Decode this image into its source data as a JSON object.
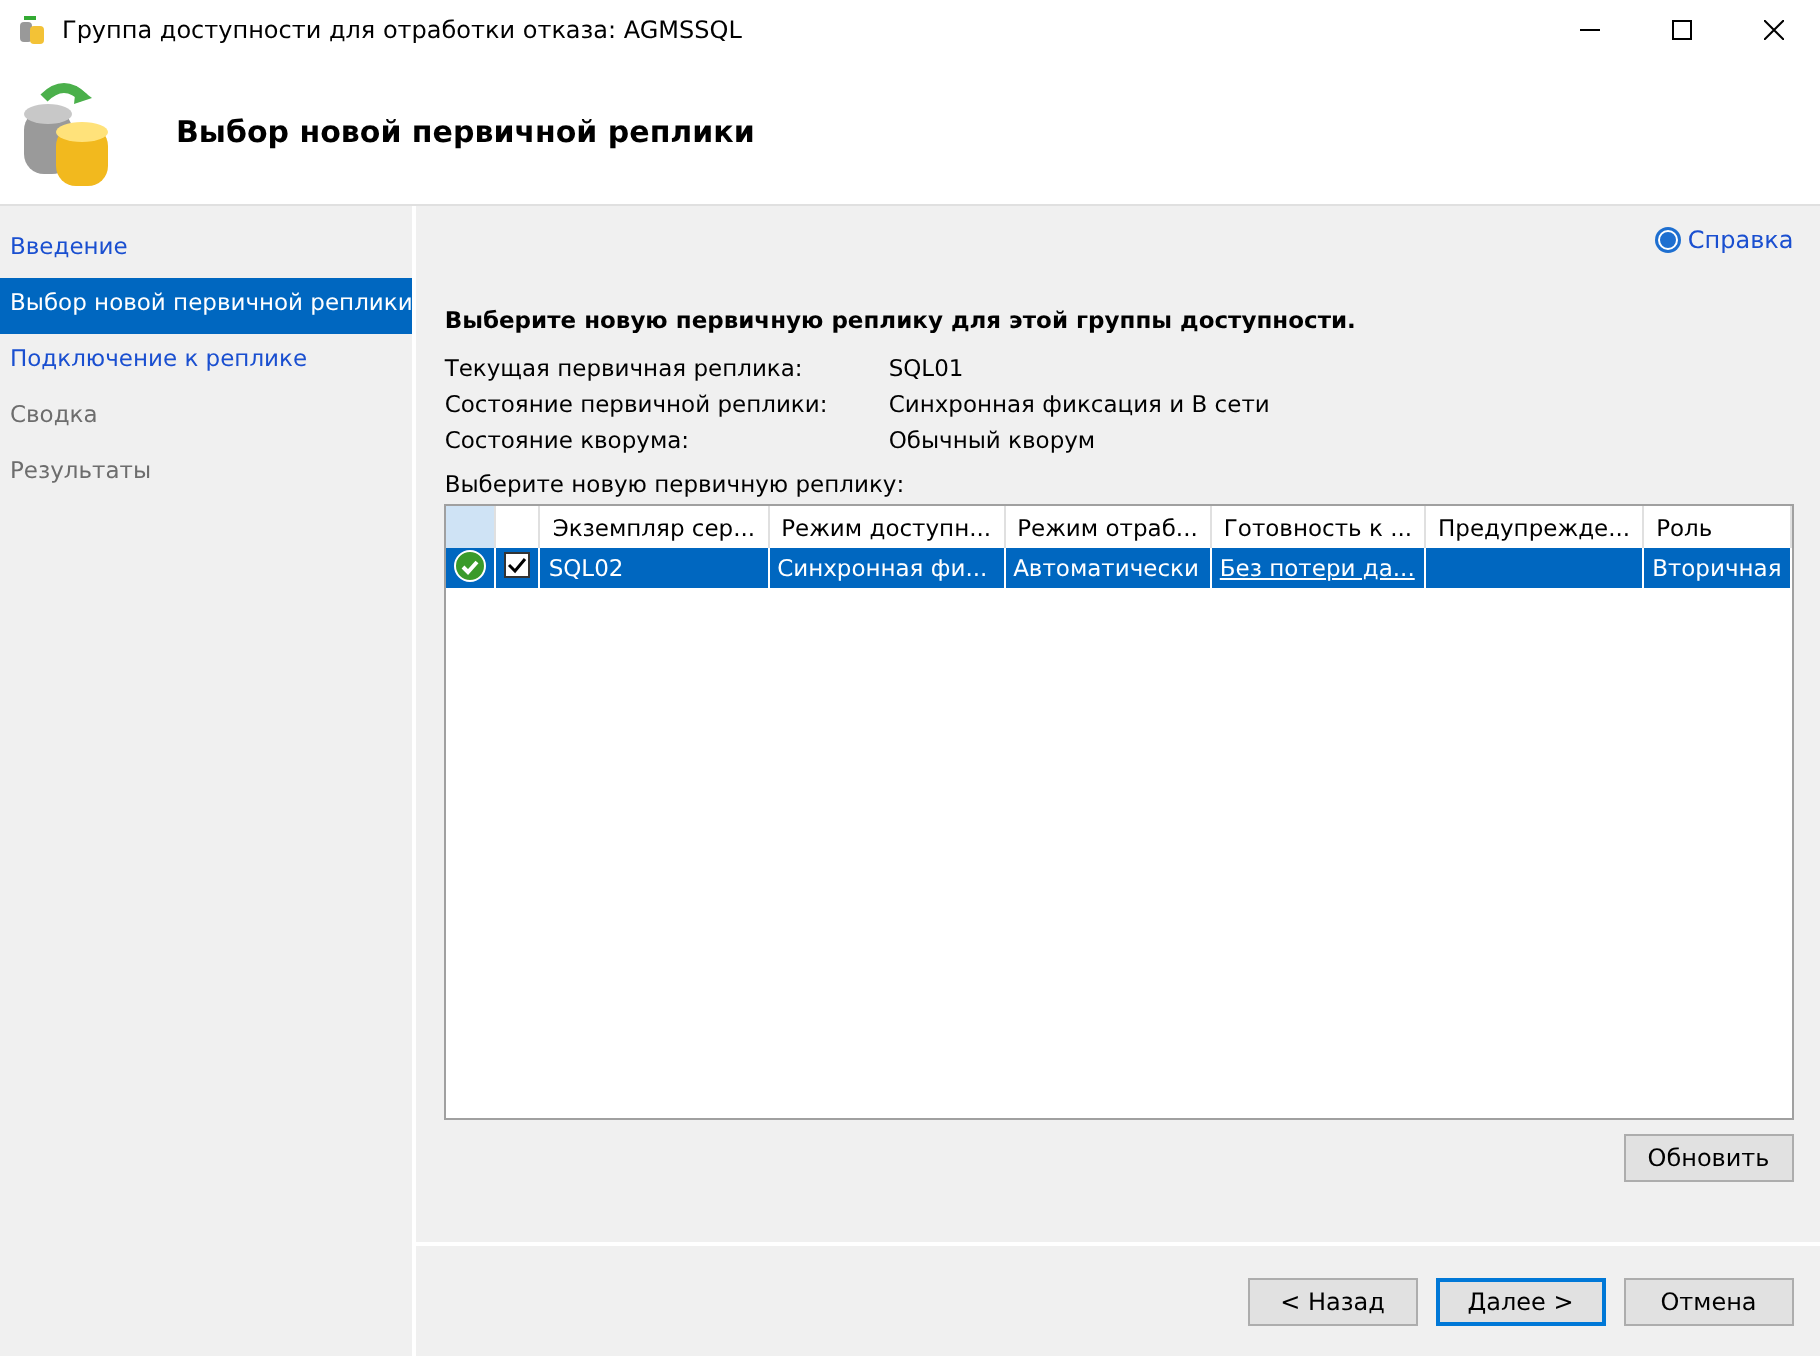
{
  "window": {
    "title": "Группа доступности для отработки отказа: AGMSSQL"
  },
  "header": {
    "title": "Выбор новой первичной реплики"
  },
  "sidebar": {
    "items": [
      {
        "label": "Введение",
        "selected": false,
        "disabled": false
      },
      {
        "label": "Выбор новой первичной реплики",
        "selected": true,
        "disabled": false
      },
      {
        "label": "Подключение к реплике",
        "selected": false,
        "disabled": false
      },
      {
        "label": "Сводка",
        "selected": false,
        "disabled": true
      },
      {
        "label": "Результаты",
        "selected": false,
        "disabled": true
      }
    ]
  },
  "help_link": "Справка",
  "instruction": "Выберите новую первичную реплику для этой группы доступности.",
  "info": [
    {
      "label": "Текущая первичная реплика:",
      "value": "SQL01"
    },
    {
      "label": "Состояние первичной реплики:",
      "value": "Синхронная фиксация и В сети"
    },
    {
      "label": "Состояние кворума:",
      "value": "Обычный кворум"
    }
  ],
  "table": {
    "caption": "Выберите новую первичную реплику:",
    "columns": [
      "Экземпляр сер...",
      "Режим доступн...",
      "Режим отраб...",
      "Готовность к ...",
      "Предупрежде...",
      "Роль"
    ],
    "rows": [
      {
        "selected": true,
        "checked": true,
        "ok": true,
        "cells": [
          "SQL02",
          "Синхронная фи...",
          "Автоматически",
          "Без потери да...",
          "",
          "Вторичная"
        ]
      }
    ]
  },
  "refresh_button": "Обновить",
  "buttons": [
    {
      "label": "< Назад",
      "default": false
    },
    {
      "label": "Далее >",
      "default": true
    },
    {
      "label": "Отмена",
      "default": false
    }
  ]
}
